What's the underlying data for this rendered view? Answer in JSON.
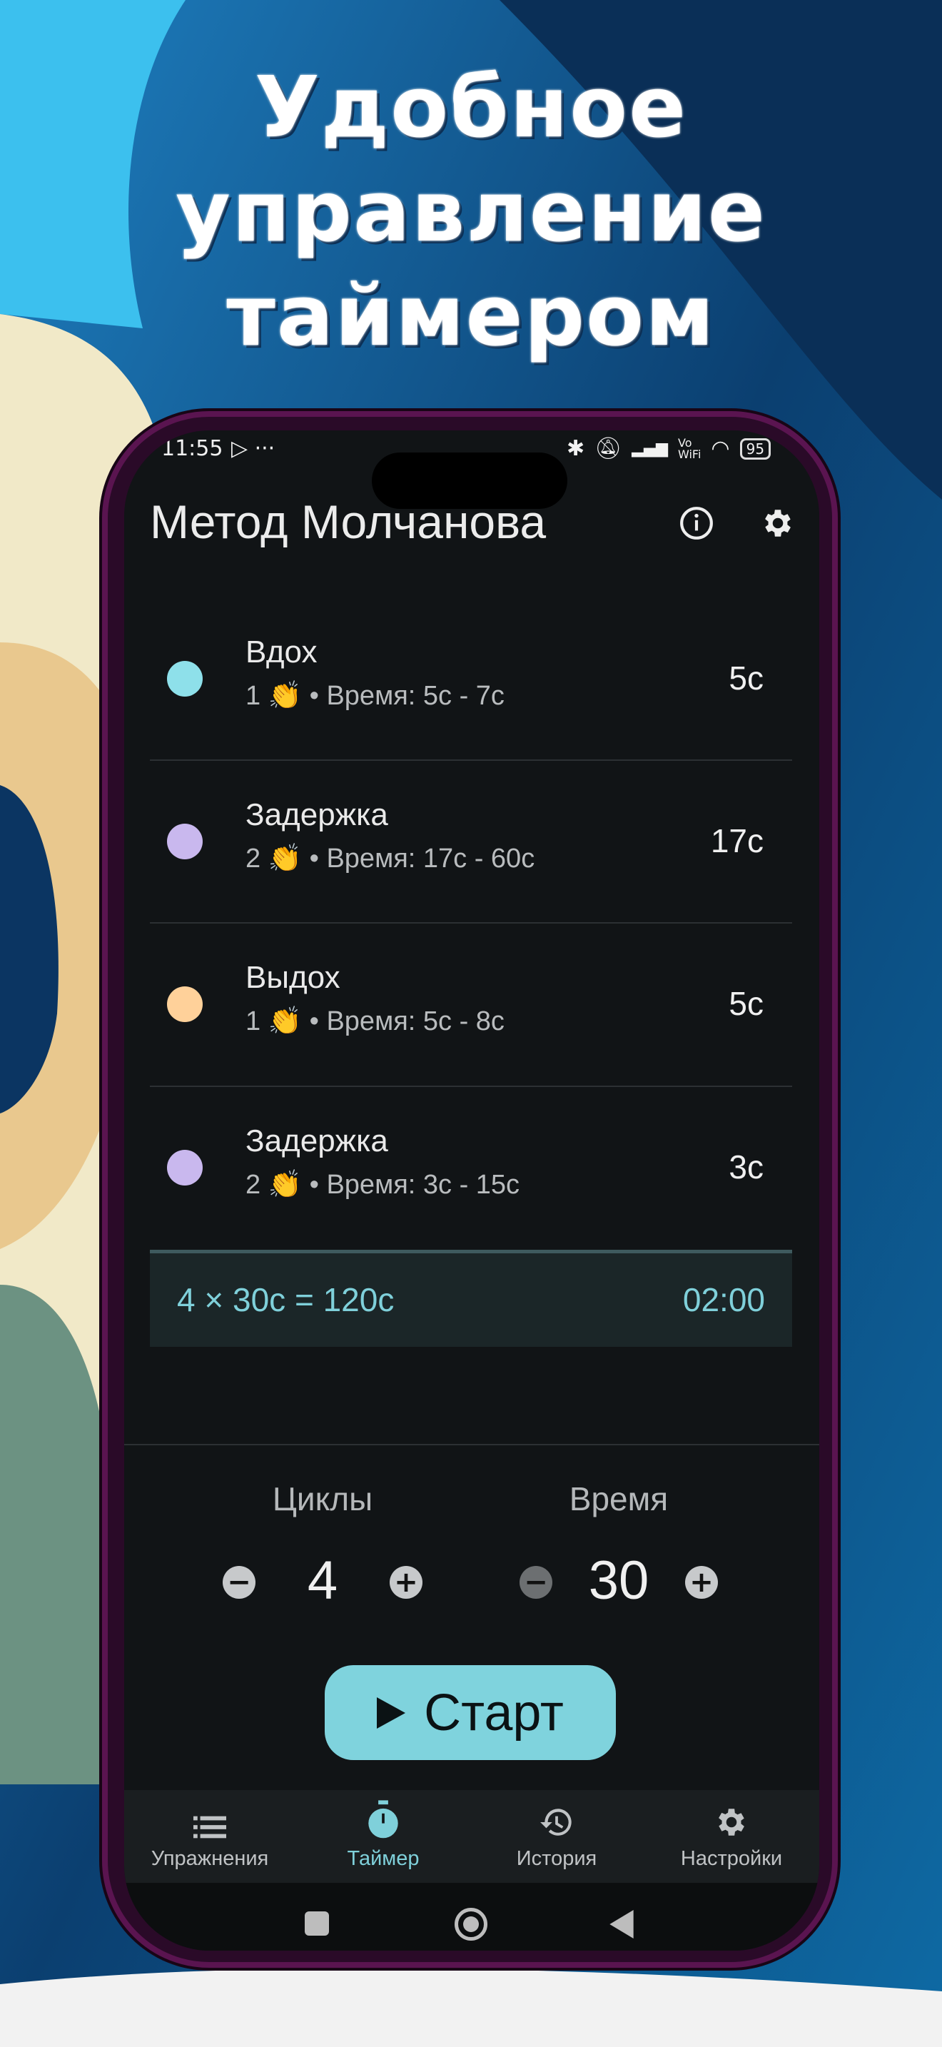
{
  "headline": [
    "Удобное",
    "управление",
    "таймером"
  ],
  "status_bar": {
    "time": "11:55",
    "battery": "95"
  },
  "app_bar": {
    "title": "Метод Молчанова"
  },
  "phases": [
    {
      "title": "Вдох",
      "reps": "1",
      "time_range": "• Время: 5с - 7с",
      "value": "5с",
      "color": "#8ee0ea"
    },
    {
      "title": "Задержка",
      "reps": "2",
      "time_range": "• Время: 17с - 60с",
      "value": "17с",
      "color": "#c9b8ee"
    },
    {
      "title": "Выдох",
      "reps": "1",
      "time_range": "• Время: 5с - 8с",
      "value": "5с",
      "color": "#ffd19a"
    },
    {
      "title": "Задержка",
      "reps": "2",
      "time_range": "• Время: 3с - 15с",
      "value": "3с",
      "color": "#c9b8ee"
    }
  ],
  "summary": {
    "formula": "4 × 30с  = 120с",
    "total": "02:00"
  },
  "controls": {
    "cycles_label": "Циклы",
    "cycles_value": "4",
    "time_label": "Время",
    "time_value": "30"
  },
  "start_label": "Старт",
  "bottom_nav": [
    {
      "label": "Упражнения",
      "icon": "list-icon"
    },
    {
      "label": "Таймер",
      "icon": "stopwatch-icon",
      "active": true
    },
    {
      "label": "История",
      "icon": "history-icon"
    },
    {
      "label": "Настройки",
      "icon": "gear-icon"
    }
  ],
  "colors": {
    "accent": "#7fd3dd",
    "background": "#111416"
  }
}
